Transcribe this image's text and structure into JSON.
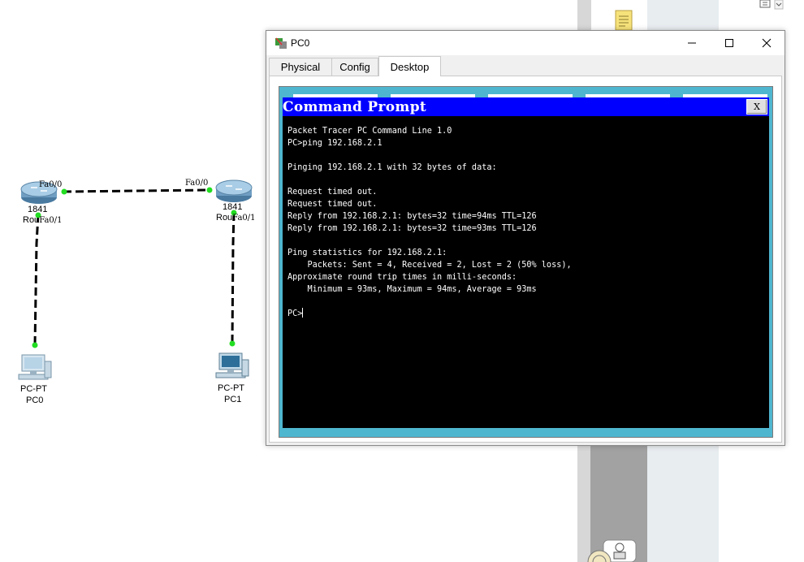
{
  "window": {
    "title": "PC0",
    "tabs": [
      {
        "label": "Physical"
      },
      {
        "label": "Config"
      },
      {
        "label": "Desktop"
      }
    ],
    "active_tab": "Desktop"
  },
  "command_prompt": {
    "title": "Command Prompt",
    "close_label": "X",
    "lines": [
      "Packet Tracer PC Command Line 1.0",
      "PC>ping 192.168.2.1",
      "",
      "Pinging 192.168.2.1 with 32 bytes of data:",
      "",
      "Request timed out.",
      "Request timed out.",
      "Reply from 192.168.2.1: bytes=32 time=94ms TTL=126",
      "Reply from 192.168.2.1: bytes=32 time=93ms TTL=126",
      "",
      "Ping statistics for 192.168.2.1:",
      "    Packets: Sent = 4, Received = 2, Lost = 2 (50% loss),",
      "Approximate round trip times in milli-seconds:",
      "    Minimum = 93ms, Maximum = 94ms, Average = 93ms",
      "",
      "PC>"
    ]
  },
  "topology": {
    "router0": {
      "model": "1841",
      "name_prefix": "Rou"
    },
    "router1": {
      "model": "1841",
      "name_prefix": "Rou"
    },
    "ports": {
      "r0_fa00": "Fa0/0",
      "r0_fa01": "Fa0/1",
      "r1_fa00": "Fa0/0",
      "r1_fa01": "Fa0/1"
    },
    "pc0": {
      "type": "PC-PT",
      "name": "PC0"
    },
    "pc1": {
      "type": "PC-PT",
      "name": "PC1"
    },
    "link_up_color": "#22dd22"
  },
  "colors": {
    "cmd_title_bg": "#0000ff",
    "desktop_bg": "#4fb6cf",
    "terminal_bg": "#000000"
  }
}
